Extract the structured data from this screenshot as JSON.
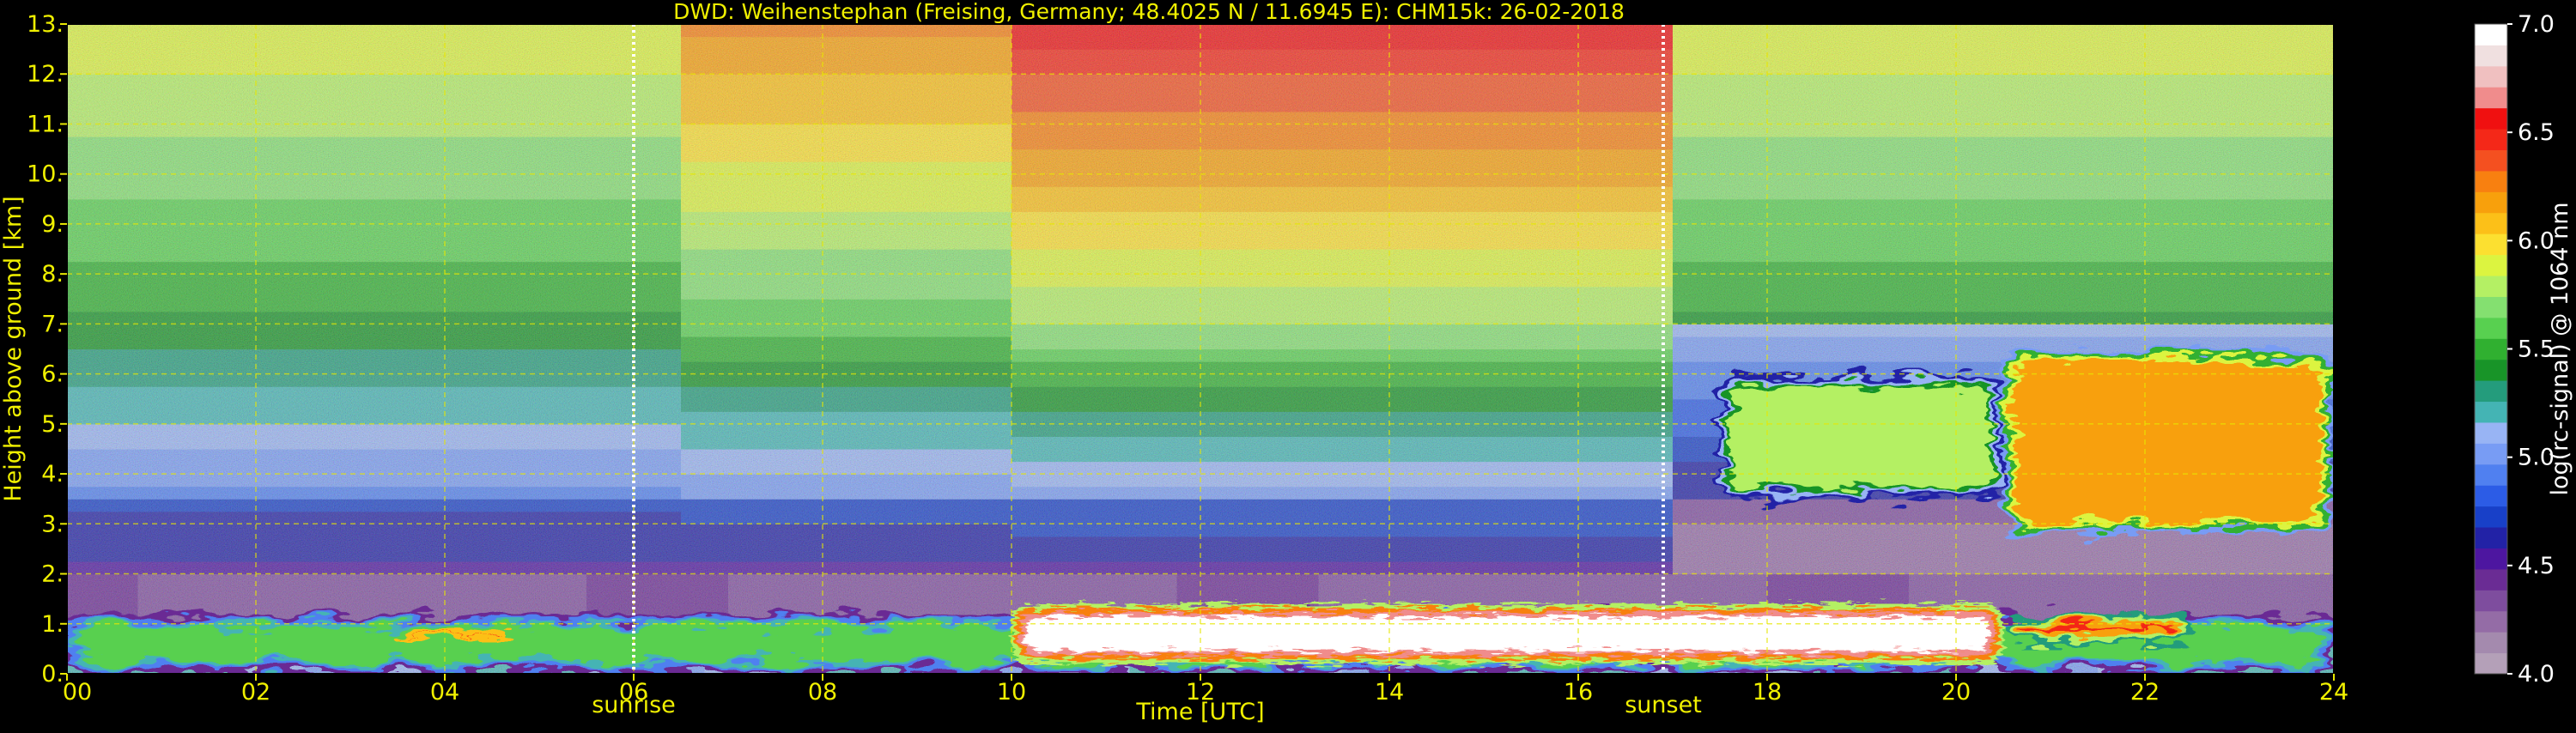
{
  "chart_data": {
    "type": "heatmap",
    "title": "DWD: Weihenstephan (Freising, Germany; 48.4025 N / 11.6945 E):    CHM15k: 26-02-2018",
    "xlabel": "Time [UTC]",
    "ylabel": "Height above ground [km]",
    "xlim": [
      0,
      24
    ],
    "ylim": [
      0,
      13
    ],
    "x_ticks": [
      "00",
      "02",
      "04",
      "06",
      "08",
      "10",
      "12",
      "14",
      "16",
      "18",
      "20",
      "22",
      "24"
    ],
    "y_ticks": [
      "0.",
      "1.",
      "2.",
      "3.",
      "4.",
      "5.",
      "6.",
      "7.",
      "8.",
      "9.",
      "10.",
      "11.",
      "12.",
      "13."
    ],
    "grid": true,
    "markers": [
      {
        "label": "sunrise",
        "x": 6.0
      },
      {
        "label": "sunset",
        "x": 16.9
      }
    ],
    "colorbar": {
      "label": "log(rc-signal) @ 1064 nm",
      "range": [
        4.0,
        7.0
      ],
      "ticks": [
        "4.0",
        "4.5",
        "5.0",
        "5.5",
        "6.0",
        "6.5",
        "7.0"
      ],
      "colors": [
        "#b4a0b8",
        "#a48aae",
        "#946ca6",
        "#7e4d9e",
        "#6a2c94",
        "#4d16a0",
        "#2222a6",
        "#1840c8",
        "#2c5ce6",
        "#5080f0",
        "#789cf4",
        "#98b4f4",
        "#44b4b4",
        "#249c7c",
        "#189428",
        "#30b030",
        "#58d050",
        "#84e070",
        "#b4f064",
        "#dcf440",
        "#fce030",
        "#fcc018",
        "#f8a00c",
        "#f88010",
        "#f45020",
        "#f42818",
        "#f01010",
        "#f08c8c",
        "#f0c0c0",
        "#f0e0e0",
        "#ffffff"
      ]
    },
    "features": [
      {
        "label": "boundary layer / aerosol",
        "x_range": [
          0,
          24
        ],
        "height_km": [
          0,
          1.2
        ],
        "level": 5.6
      },
      {
        "label": "low cloud",
        "x_range": [
          10,
          20.5
        ],
        "height_km": [
          0.2,
          1.4
        ],
        "level": 7.0
      },
      {
        "label": "low cloud",
        "x_range": [
          20.5,
          22.5
        ],
        "height_km": [
          0.6,
          1.2
        ],
        "level": 6.5
      },
      {
        "label": "cloud",
        "x_range": [
          3.4,
          4.8
        ],
        "height_km": [
          0.6,
          0.95
        ],
        "level": 6.8
      },
      {
        "label": "mid cloud",
        "x_range": [
          20.5,
          24
        ],
        "height_km": [
          2.8,
          6.5
        ],
        "level": 6.2
      },
      {
        "label": "virga streaks",
        "x_range": [
          17.5,
          20.5
        ],
        "height_km": [
          3.5,
          6.0
        ],
        "level": 5.8
      }
    ]
  }
}
